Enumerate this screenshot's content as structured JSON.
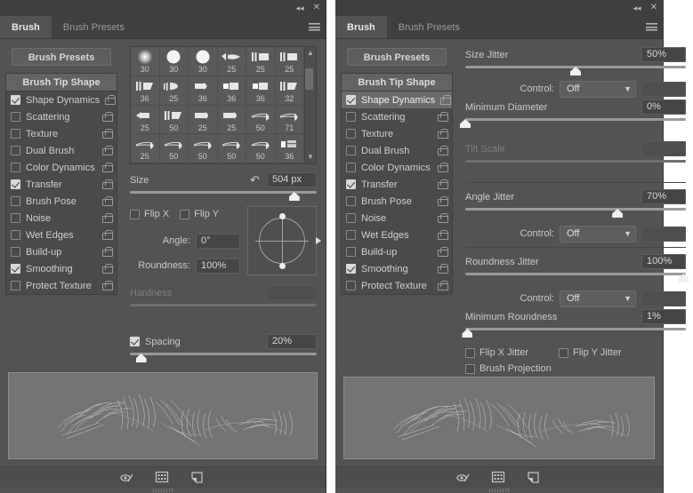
{
  "window": {
    "collapse_icon": "collapse-icon",
    "close_icon": "close-icon",
    "menu_icon": "panel-menu-icon"
  },
  "tabs": [
    {
      "label": "Brush",
      "active": true
    },
    {
      "label": "Brush Presets",
      "active": false
    }
  ],
  "presets_button": "Brush Presets",
  "options_header": "Brush Tip Shape",
  "options": [
    {
      "label": "Shape Dynamics",
      "checked": true,
      "selected": false
    },
    {
      "label": "Scattering",
      "checked": false,
      "selected": false
    },
    {
      "label": "Texture",
      "checked": false,
      "selected": false
    },
    {
      "label": "Dual Brush",
      "checked": false,
      "selected": false
    },
    {
      "label": "Color Dynamics",
      "checked": false,
      "selected": false
    },
    {
      "label": "Transfer",
      "checked": true,
      "selected": false
    },
    {
      "label": "Brush Pose",
      "checked": false,
      "selected": false
    },
    {
      "label": "Noise",
      "checked": false,
      "selected": false
    },
    {
      "label": "Wet Edges",
      "checked": false,
      "selected": false
    },
    {
      "label": "Build-up",
      "checked": false,
      "selected": false
    },
    {
      "label": "Smoothing",
      "checked": true,
      "selected": false
    },
    {
      "label": "Protect Texture",
      "checked": false,
      "selected": false
    }
  ],
  "left_panel": {
    "brush_grid": [
      {
        "num": "30",
        "tip": "soft-round"
      },
      {
        "num": "30",
        "tip": "hard-round"
      },
      {
        "num": "30",
        "tip": "hard-round"
      },
      {
        "num": "25",
        "tip": "flat-angle"
      },
      {
        "num": "25",
        "tip": "flat-block"
      },
      {
        "num": "25",
        "tip": "flat-block"
      },
      {
        "num": "36",
        "tip": "flat-fan"
      },
      {
        "num": "25",
        "tip": "flat-bristle"
      },
      {
        "num": "36",
        "tip": "round-point"
      },
      {
        "num": "36",
        "tip": "flat-square"
      },
      {
        "num": "36",
        "tip": "flat-square"
      },
      {
        "num": "32",
        "tip": "flat-fan"
      },
      {
        "num": "25",
        "tip": "round-blunt"
      },
      {
        "num": "50",
        "tip": "flat-fan"
      },
      {
        "num": "25",
        "tip": "flat-taper"
      },
      {
        "num": "25",
        "tip": "flat-taper"
      },
      {
        "num": "50",
        "tip": "pencil-tip"
      },
      {
        "num": "71",
        "tip": "pencil-tip"
      },
      {
        "num": "25",
        "tip": "pencil-tip"
      },
      {
        "num": "50",
        "tip": "pencil-tip"
      },
      {
        "num": "50",
        "tip": "pencil-tip"
      },
      {
        "num": "50",
        "tip": "pencil-tip"
      },
      {
        "num": "50",
        "tip": "pencil-tip"
      },
      {
        "num": "36",
        "tip": "flat-split"
      }
    ],
    "size": {
      "label": "Size",
      "value": "504 px",
      "slider_pct": 88,
      "reset_icon": "reset-arrow-icon"
    },
    "flip_x": {
      "label": "Flip X",
      "checked": false
    },
    "flip_y": {
      "label": "Flip Y",
      "checked": false
    },
    "angle": {
      "label": "Angle:",
      "value": "0°"
    },
    "roundness": {
      "label": "Roundness:",
      "value": "100%"
    },
    "hardness": {
      "label": "Hardness",
      "value": "",
      "slider_pct": 0,
      "disabled": true
    },
    "spacing": {
      "label": "Spacing",
      "checked": true,
      "value": "20%",
      "slider_pct": 6
    }
  },
  "right_panel": {
    "size_jitter": {
      "label": "Size Jitter",
      "value": "50%",
      "slider_pct": 50
    },
    "size_control": {
      "label": "Control:",
      "value": "Off"
    },
    "minimum_diameter": {
      "label": "Minimum Diameter",
      "value": "0%",
      "slider_pct": 0
    },
    "tilt_scale": {
      "label": "Tilt Scale",
      "value": "",
      "slider_pct": 0,
      "disabled": true
    },
    "angle_jitter": {
      "label": "Angle Jitter",
      "value": "70%",
      "slider_pct": 69
    },
    "angle_control": {
      "label": "Control:",
      "value": "Off"
    },
    "roundness_jitter": {
      "label": "Roundness Jitter",
      "value": "100%",
      "slider_pct": 99
    },
    "roundness_control": {
      "label": "Control:",
      "value": "Off"
    },
    "minimum_roundness": {
      "label": "Minimum Roundness",
      "value": "1%",
      "slider_pct": 1
    },
    "flip_x_jitter": {
      "label": "Flip X Jitter",
      "checked": false
    },
    "flip_y_jitter": {
      "label": "Flip Y Jitter",
      "checked": false
    },
    "brush_projection": {
      "label": "Brush Projection",
      "checked": false
    }
  },
  "footer": {
    "toggle_icon": "brush-pressure-toggle-icon",
    "presets_icon": "new-preset-grid-icon",
    "new_icon": "new-brush-icon"
  },
  "colors": {
    "panel_bg": "#535353",
    "tabbar_bg": "#3f3f3f",
    "selected_row": "#6b6b6b",
    "slider_track": "#9a9a9a",
    "thumb": "#f0f0f0",
    "text": "#c9c9c9",
    "preview_bg": "#737373"
  }
}
